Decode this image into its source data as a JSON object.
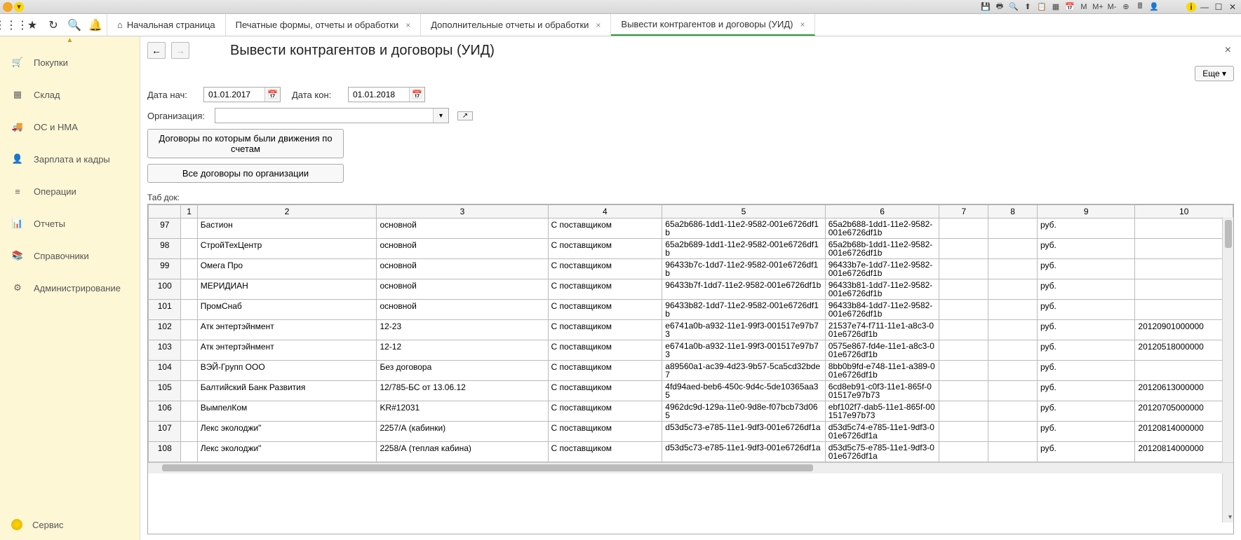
{
  "chrome": {
    "right_labels": [
      "M",
      "M+",
      "M-"
    ]
  },
  "toolbar": {
    "home": "Начальная страница"
  },
  "tabs": [
    "Печатные формы, отчеты и обработки",
    "Дополнительные отчеты и обработки",
    "Вывести контрагентов и договоры (УИД)"
  ],
  "sidebar": {
    "items": [
      {
        "label": "Покупки"
      },
      {
        "label": "Склад"
      },
      {
        "label": "ОС и НМА"
      },
      {
        "label": "Зарплата и кадры"
      },
      {
        "label": "Операции"
      },
      {
        "label": "Отчеты"
      },
      {
        "label": "Справочники"
      },
      {
        "label": "Администрирование"
      }
    ],
    "service": "Сервис"
  },
  "page": {
    "title": "Вывести контрагентов и договоры (УИД)",
    "more": "Еще",
    "date_start_label": "Дата нач:",
    "date_end_label": "Дата кон:",
    "date_start": "01.01.2017",
    "date_end": "01.01.2018",
    "org_label": "Организация:",
    "org_value": "",
    "btn_moved": "Договоры по которым были движения по счетам",
    "btn_all": "Все договоры по организации",
    "table_label": "Таб док:"
  },
  "table": {
    "headers": [
      "",
      "1",
      "2",
      "3",
      "4",
      "5",
      "6",
      "7",
      "8",
      "9",
      "10"
    ],
    "rows": [
      {
        "n": "97",
        "c2": "Бастион",
        "c3": "основной",
        "c4": "С поставщиком",
        "c5": "65a2b686-1dd1-11e2-9582-001e6726df1b",
        "c6": "65a2b688-1dd1-11e2-9582-001e6726df1b",
        "c7": "",
        "c8": "",
        "c9": "руб.",
        "c10": ""
      },
      {
        "n": "98",
        "c2": "СтройТехЦентр",
        "c3": "основной",
        "c4": "С поставщиком",
        "c5": "65a2b689-1dd1-11e2-9582-001e6726df1b",
        "c6": "65a2b68b-1dd1-11e2-9582-001e6726df1b",
        "c7": "",
        "c8": "",
        "c9": "руб.",
        "c10": ""
      },
      {
        "n": "99",
        "c2": "Омега Про",
        "c3": "основной",
        "c4": "С поставщиком",
        "c5": "96433b7c-1dd7-11e2-9582-001e6726df1b",
        "c6": "96433b7e-1dd7-11e2-9582-001e6726df1b",
        "c7": "",
        "c8": "",
        "c9": "руб.",
        "c10": ""
      },
      {
        "n": "100",
        "c2": "МЕРИДИАН",
        "c3": "основной",
        "c4": "С поставщиком",
        "c5": "96433b7f-1dd7-11e2-9582-001e6726df1b",
        "c6": "96433b81-1dd7-11e2-9582-001e6726df1b",
        "c7": "",
        "c8": "",
        "c9": "руб.",
        "c10": ""
      },
      {
        "n": "101",
        "c2": "ПромСнаб",
        "c3": "основной",
        "c4": "С поставщиком",
        "c5": "96433b82-1dd7-11e2-9582-001e6726df1b",
        "c6": "96433b84-1dd7-11e2-9582-001e6726df1b",
        "c7": "",
        "c8": "",
        "c9": "руб.",
        "c10": ""
      },
      {
        "n": "102",
        "c2": "Атк энтертэйнмент",
        "c3": "12-23",
        "c4": "С поставщиком",
        "c5": "e6741a0b-a932-11e1-99f3-001517e97b73",
        "c6": "21537e74-f711-11e1-a8c3-001e6726df1b",
        "c7": "",
        "c8": "",
        "c9": "руб.",
        "c10": "20120901000000"
      },
      {
        "n": "103",
        "c2": "Атк энтертэйнмент",
        "c3": "12-12",
        "c4": "С поставщиком",
        "c5": "e6741a0b-a932-11e1-99f3-001517e97b73",
        "c6": "0575e867-fd4e-11e1-a8c3-001e6726df1b",
        "c7": "",
        "c8": "",
        "c9": "руб.",
        "c10": "20120518000000"
      },
      {
        "n": "104",
        "c2": "ВЭЙ-Групп ООО",
        "c3": "Без договора",
        "c4": "С поставщиком",
        "c5": "a89560a1-ac39-4d23-9b57-5ca5cd32bde7",
        "c6": "8bb0b9fd-e748-11e1-a389-001e6726df1b",
        "c7": "",
        "c8": "",
        "c9": "руб.",
        "c10": ""
      },
      {
        "n": "105",
        "c2": "Балтийский Банк Развития",
        "c3": "12/785-БС от 13.06.12",
        "c4": "С поставщиком",
        "c5": "4fd94aed-beb6-450c-9d4c-5de10365aa35",
        "c6": "6cd8eb91-c0f3-11e1-865f-001517e97b73",
        "c7": "",
        "c8": "",
        "c9": "руб.",
        "c10": "20120613000000"
      },
      {
        "n": "106",
        "c2": "ВымпелКом",
        "c3": "KR#12031",
        "c4": "С поставщиком",
        "c5": "4962dc9d-129a-11e0-9d8e-f07bcb73d065",
        "c6": "ebf102f7-dab5-11e1-865f-001517e97b73",
        "c7": "",
        "c8": "",
        "c9": "руб.",
        "c10": "20120705000000"
      },
      {
        "n": "107",
        "c2": "Лекс эколоджи\"",
        "c3": "2257/А (кабинки)",
        "c4": "С поставщиком",
        "c5": "d53d5c73-e785-11e1-9df3-001e6726df1a",
        "c6": "d53d5c74-e785-11e1-9df3-001e6726df1a",
        "c7": "",
        "c8": "",
        "c9": "руб.",
        "c10": "20120814000000"
      },
      {
        "n": "108",
        "c2": "Лекс эколоджи\"",
        "c3": "2258/А (теплая кабина)",
        "c4": "С поставщиком",
        "c5": "d53d5c73-e785-11e1-9df3-001e6726df1a",
        "c6": "d53d5c75-e785-11e1-9df3-001e6726df1a",
        "c7": "",
        "c8": "",
        "c9": "руб.",
        "c10": "20120814000000"
      }
    ]
  }
}
